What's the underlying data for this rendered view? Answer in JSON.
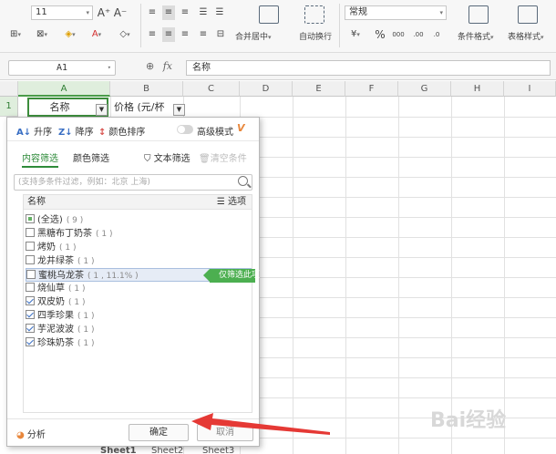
{
  "ribbon": {
    "font_size": "11",
    "grow_font": "A⁺",
    "shrink_font": "A⁻",
    "number_format": "常规",
    "currency_symbol": "¥",
    "percent_symbol": "%",
    "thousands_symbol": "000",
    "inc_decimal": ".00",
    "dec_decimal": ".0",
    "merge_center": "合并居中",
    "wrap_text": "自动换行",
    "conditional_format": "条件格式",
    "table_style": "表格样式"
  },
  "formula_bar": {
    "name_box": "A1",
    "fx": "fx",
    "content": "名称"
  },
  "grid": {
    "columns": [
      "A",
      "B",
      "C",
      "D",
      "E",
      "F",
      "G",
      "H",
      "I"
    ],
    "rows": [
      "1"
    ],
    "cell_a1": "名称",
    "cell_b1": "价格 (元/杯"
  },
  "filter_panel": {
    "sort_asc": "升序",
    "sort_desc": "降序",
    "sort_color": "颜色排序",
    "advanced_mode": "高级模式",
    "vip_badge": "V",
    "tab_content": "内容筛选",
    "tab_color": "颜色筛选",
    "text_filter": "文本筛选",
    "clear_filter": "清空条件",
    "search_placeholder": "(支持多条件过滤，例如：北京 上海)",
    "list_header_name": "名称",
    "list_header_options": "选项",
    "items": [
      {
        "label": "(全选)",
        "count": "( 9 )"
      },
      {
        "label": "黑糖布丁奶茶",
        "count": "( 1 )"
      },
      {
        "label": "烤奶",
        "count": "( 1 )"
      },
      {
        "label": "龙井绿茶",
        "count": "( 1 )"
      },
      {
        "label": "蜜桃乌龙茶",
        "count": "( 1 , 11.1% )"
      },
      {
        "label": "烧仙草",
        "count": "( 1 )"
      },
      {
        "label": "双皮奶",
        "count": "( 1 )"
      },
      {
        "label": "四季珍果",
        "count": "( 1 )"
      },
      {
        "label": "芋泥波波",
        "count": "( 1 )"
      },
      {
        "label": "珍珠奶茶",
        "count": "( 1 )"
      }
    ],
    "only_this": "仅筛选此项",
    "analysis": "分析",
    "ok": "确定",
    "cancel": "取消"
  },
  "sheets": [
    "Sheet1",
    "Sheet2",
    "Sheet3"
  ],
  "watermark": "Bai经验",
  "colors": {
    "accent_green": "#2e8b3a",
    "arrow_red": "#e53935",
    "tag_green": "#4caf50"
  }
}
